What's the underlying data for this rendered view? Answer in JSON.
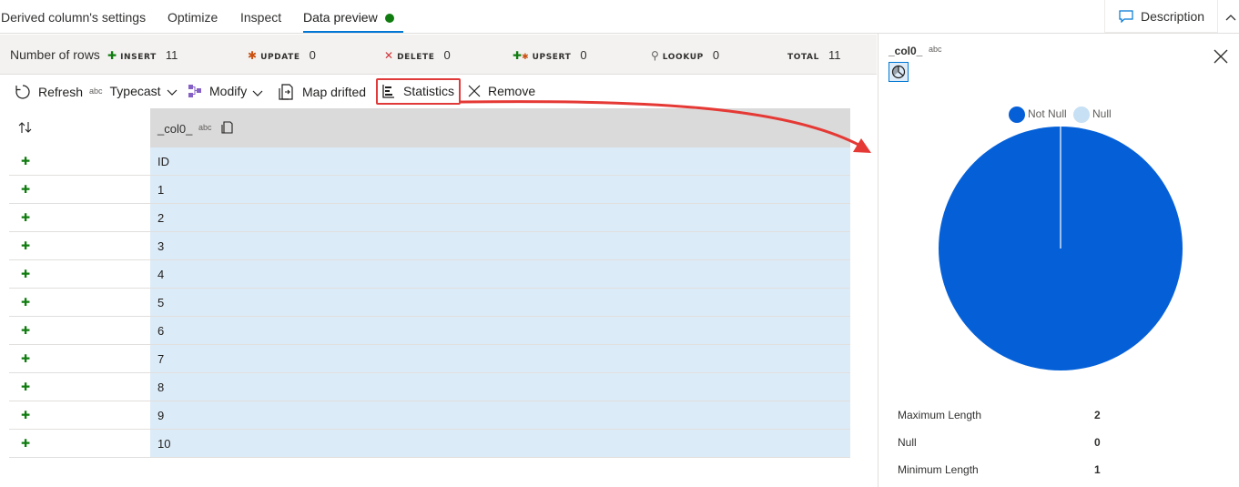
{
  "tabs": [
    {
      "label": "Derived column's settings"
    },
    {
      "label": "Optimize"
    },
    {
      "label": "Inspect"
    },
    {
      "label": "Data preview"
    }
  ],
  "description_button": {
    "label": "Description"
  },
  "counts": {
    "label": "Number of rows",
    "items": [
      {
        "key": "INSERT",
        "value": "11"
      },
      {
        "key": "UPDATE",
        "value": "0"
      },
      {
        "key": "DELETE",
        "value": "0"
      },
      {
        "key": "UPSERT",
        "value": "0"
      },
      {
        "key": "LOOKUP",
        "value": "0"
      },
      {
        "key": "TOTAL",
        "value": "11"
      }
    ]
  },
  "toolbar": {
    "refresh": "Refresh",
    "typecast_type": "abc",
    "typecast": "Typecast",
    "modify": "Modify",
    "map_drifted": "Map drifted",
    "statistics": "Statistics",
    "remove": "Remove"
  },
  "grid": {
    "column": {
      "name": "_col0_",
      "type": "abc"
    },
    "rows": [
      "ID",
      "1",
      "2",
      "3",
      "4",
      "5",
      "6",
      "7",
      "8",
      "9",
      "10"
    ]
  },
  "stats_panel": {
    "column_name": "_col0_",
    "column_type": "abc",
    "legend": [
      {
        "label": "Not Null",
        "color": "#0560d8"
      },
      {
        "label": "Null",
        "color": "#c7e0f4"
      }
    ],
    "stats": [
      {
        "label": "Maximum Length",
        "value": "2"
      },
      {
        "label": "Null",
        "value": "0"
      },
      {
        "label": "Minimum Length",
        "value": "1"
      }
    ]
  },
  "chart_data": {
    "type": "pie",
    "categories": [
      "Not Null",
      "Null"
    ],
    "values": [
      11,
      0
    ],
    "legend_position": "top"
  },
  "colors": {
    "accent": "#0078d4",
    "status_ok": "#107c10",
    "highlight": "#e03a3a",
    "cell_bg": "#dcebf8",
    "pie_not_null": "#0560d8"
  }
}
